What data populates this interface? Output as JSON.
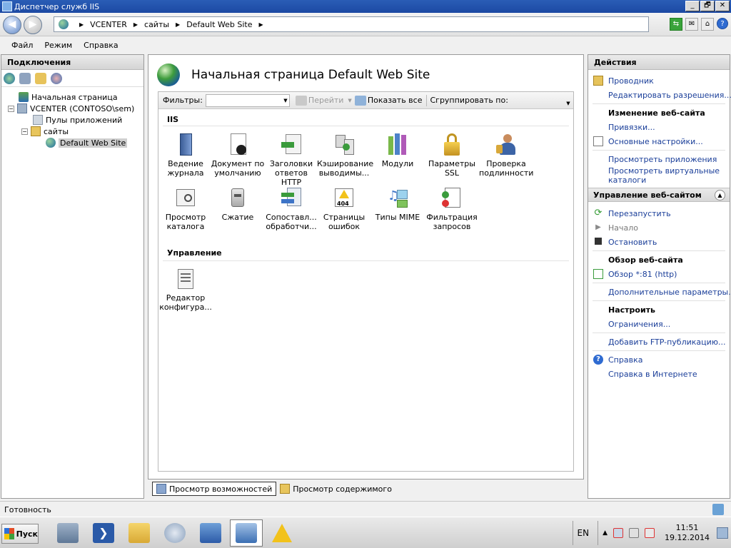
{
  "window": {
    "title": "Диспетчер служб IIS",
    "controls": {
      "minimize": "_",
      "maximize": "🗗",
      "close": "✕"
    }
  },
  "address": {
    "crumbs": [
      "VCENTER",
      "сайты",
      "Default Web Site"
    ]
  },
  "menu": [
    "Файл",
    "Режим",
    "Справка"
  ],
  "connections": {
    "header": "Подключения",
    "tree": [
      {
        "label": "Начальная страница",
        "level": 0
      },
      {
        "label": "VCENTER (CONTOSO\\sem)",
        "level": 0,
        "expander": "−"
      },
      {
        "label": "Пулы приложений",
        "level": 1
      },
      {
        "label": "сайты",
        "level": 1,
        "expander": "−"
      },
      {
        "label": "Default Web Site",
        "level": 2,
        "selected": true
      }
    ]
  },
  "main": {
    "title": "Начальная страница Default Web Site",
    "filter": {
      "label": "Фильтры:",
      "go": "Перейти",
      "show_all": "Показать все",
      "group_by": "Сгруппировать по:"
    },
    "groups": [
      {
        "name": "IIS",
        "features": [
          {
            "label1": "Ведение",
            "label2": "журнала",
            "icon": "log-book-icon"
          },
          {
            "label1": "Документ по",
            "label2": "умолчанию",
            "icon": "default-document-icon"
          },
          {
            "label1": "Заголовки",
            "label2": "ответов HTTP",
            "icon": "http-headers-icon"
          },
          {
            "label1": "Кэширование",
            "label2": "выводимы...",
            "icon": "output-caching-icon"
          },
          {
            "label1": "Модули",
            "label2": "",
            "icon": "modules-icon"
          },
          {
            "label1": "Параметры",
            "label2": "SSL",
            "icon": "ssl-lock-icon"
          },
          {
            "label1": "Проверка",
            "label2": "подлинности",
            "icon": "authentication-icon"
          },
          {
            "label1": "Просмотр",
            "label2": "каталога",
            "icon": "directory-browsing-icon"
          },
          {
            "label1": "Сжатие",
            "label2": "",
            "icon": "compression-icon"
          },
          {
            "label1": "Сопоставл...",
            "label2": "обработчи...",
            "icon": "handler-mappings-icon"
          },
          {
            "label1": "Страницы",
            "label2": "ошибок",
            "icon": "error-pages-icon"
          },
          {
            "label1": "Типы MIME",
            "label2": "",
            "icon": "mime-types-icon"
          },
          {
            "label1": "Фильтрация",
            "label2": "запросов",
            "icon": "request-filtering-icon"
          }
        ]
      },
      {
        "name": "Управление",
        "features": [
          {
            "label1": "Редактор",
            "label2": "конфигура...",
            "icon": "configuration-editor-icon"
          }
        ]
      }
    ],
    "view_tabs": [
      "Просмотр возможностей",
      "Просмотр содержимого"
    ]
  },
  "actions": {
    "header": "Действия",
    "explore": "Проводник",
    "edit_permissions": "Редактировать разрешения...",
    "edit_site_header": "Изменение веб-сайта",
    "bindings": "Привязки...",
    "basic_settings": "Основные настройки...",
    "view_apps": "Просмотреть приложения",
    "view_vdirs_1": "Просмотреть виртуальные",
    "view_vdirs_2": "каталоги",
    "manage_header": "Управление веб-сайтом",
    "restart": "Перезапустить",
    "start": "Начало",
    "stop": "Остановить",
    "browse_header": "Обзор веб-сайта",
    "browse": "Обзор *:81 (http)",
    "advanced": "Дополнительные параметры...",
    "configure_header": "Настроить",
    "limits": "Ограничения...",
    "add_ftp": "Добавить FTP-публикацию...",
    "help": "Справка",
    "online_help": "Справка в Интернете"
  },
  "status": {
    "text": "Готовность"
  },
  "taskbar": {
    "start": "Пуск",
    "lang": "EN",
    "time": "11:51",
    "date": "19.12.2014"
  }
}
